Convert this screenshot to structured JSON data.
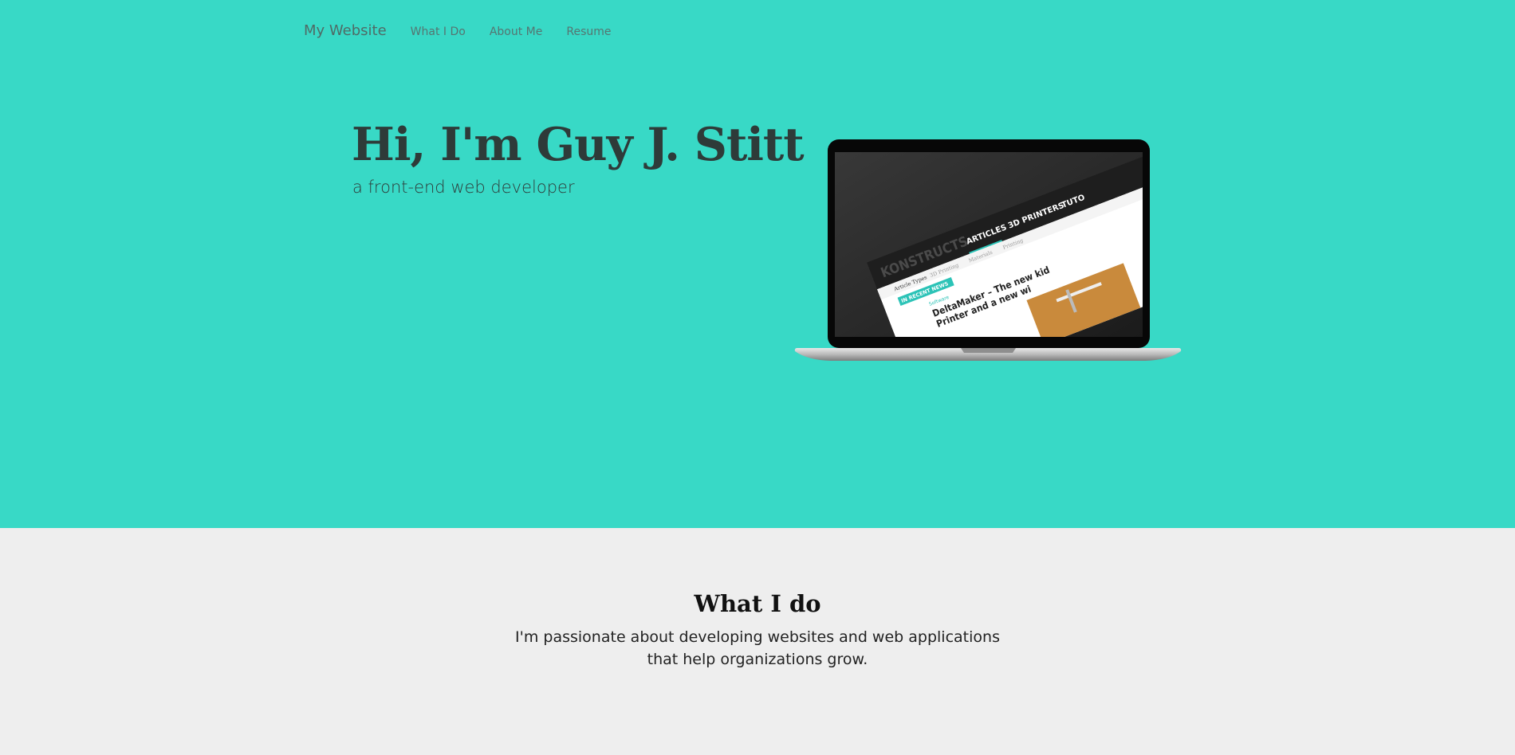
{
  "nav": {
    "brand": "My Website",
    "links": [
      "What I Do",
      "About Me",
      "Resume"
    ]
  },
  "hero": {
    "title": "Hi, I'm Guy J. Stitt",
    "subtitle": "a front-end web developer"
  },
  "laptop_screen": {
    "logo": "KONSTRUCTS",
    "menu": [
      "ARTICLES",
      "3D PRINTERS",
      "TUTO"
    ],
    "submenu": [
      "Article Types",
      "3D Printing",
      "Materials",
      "Printing"
    ],
    "badge": "IN RECENT NEWS",
    "tag": "Software",
    "headline_line1": "DeltaMaker – The new kid",
    "headline_line2": "Printer and a new wi"
  },
  "what_i_do": {
    "title": "What I do",
    "text_line1": "I'm passionate about developing websites and web applications",
    "text_line2": "that help organizations grow."
  },
  "colors": {
    "hero_bg": "#38d9c6",
    "section_bg": "#eeeeee",
    "accent": "#2cc3b7"
  }
}
